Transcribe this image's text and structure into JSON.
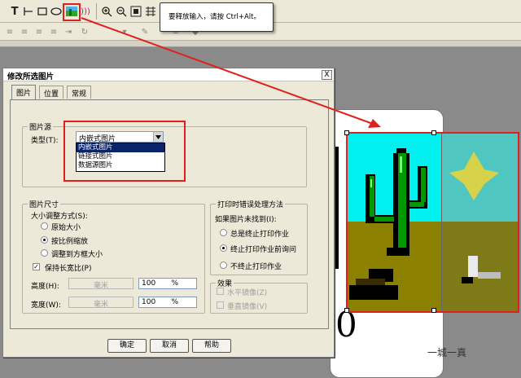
{
  "toolbar": {
    "tooltip": "要释放输入，请按 Ctrl+Alt。",
    "tools": [
      "text-tool-icon",
      "line-tool-icon",
      "rect-tool-icon",
      "ellipse-tool-icon",
      "image-tool-icon",
      "rfid-tool-icon",
      "zoom-in-icon",
      "zoom-out-icon",
      "fit-page-icon",
      "grid-icon"
    ]
  },
  "dialog": {
    "title": "修改所选图片",
    "close": "X",
    "tabs": [
      "图片",
      "位置",
      "常规"
    ],
    "source_group": {
      "label": "图片源",
      "type_label": "类型(T):",
      "selected": "内嵌式图片",
      "options": [
        "内嵌式图片",
        "链接式图片",
        "数据源图片"
      ]
    },
    "size_group": {
      "label": "图片尺寸",
      "mode_label": "大小调整方式(S):",
      "modes": [
        "原始大小",
        "按比例缩放",
        "调整到方框大小"
      ],
      "selected_mode": "按比例缩放",
      "keep_ratio": "保持长宽比(P)",
      "height_label": "高度(H):",
      "width_label": "宽度(W):",
      "unit_mm": "毫米",
      "height_pct": "100",
      "width_pct": "100",
      "pct": "%"
    },
    "error_group": {
      "label": "打印时错误处理方法",
      "question": "如果图片未找到(I):",
      "options": [
        "总是终止打印作业",
        "终止打印作业前询问",
        "不终止打印作业"
      ],
      "selected": "终止打印作业前询问"
    },
    "effect_group": {
      "label": "效果",
      "flip_h": "水平镜像(Z)",
      "flip_v": "垂直镜像(V)"
    },
    "buttons": {
      "ok": "确定",
      "cancel": "取消",
      "help": "帮助"
    }
  },
  "canvas": {
    "big_text": "0"
  },
  "watermark": "一城一真",
  "colors": {
    "highlight": "#e0201d",
    "sky": "#00f0f0",
    "ground": "#8b8000",
    "cactus": "#008000"
  }
}
